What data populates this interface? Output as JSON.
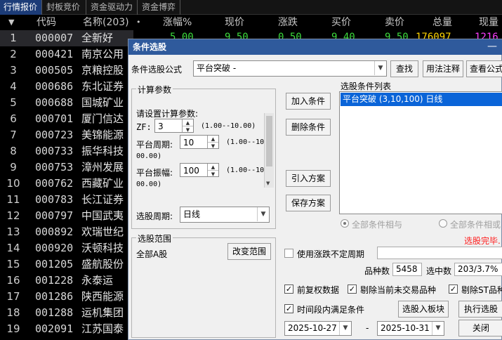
{
  "tabs": [
    "行情报价",
    "封板竞价",
    "资金驱动力",
    "资金博弈"
  ],
  "header": {
    "cols": [
      "代码",
      "名称(203)",
      "•",
      "涨幅%",
      "现价",
      "涨跌",
      "买价",
      "卖价",
      "总量",
      "现量"
    ],
    "sort_arrow": "▼"
  },
  "top_row": {
    "pct": "5.00",
    "price": "9.50",
    "chg": "0.50",
    "bid": "9.40",
    "ask": "9.50",
    "vol": "176097",
    "cur": "1216"
  },
  "rows": [
    {
      "n": "1",
      "code": "000007",
      "name": "全新好"
    },
    {
      "n": "2",
      "code": "000421",
      "name": "南京公用"
    },
    {
      "n": "3",
      "code": "000505",
      "name": "京粮控股"
    },
    {
      "n": "4",
      "code": "000686",
      "name": "东北证券"
    },
    {
      "n": "5",
      "code": "000688",
      "name": "国城矿业"
    },
    {
      "n": "6",
      "code": "000701",
      "name": "厦门信达"
    },
    {
      "n": "7",
      "code": "000723",
      "name": "美锦能源"
    },
    {
      "n": "8",
      "code": "000733",
      "name": "振华科技"
    },
    {
      "n": "9",
      "code": "000753",
      "name": "漳州发展"
    },
    {
      "n": "10",
      "code": "000762",
      "name": "西藏矿业"
    },
    {
      "n": "11",
      "code": "000783",
      "name": "长江证券"
    },
    {
      "n": "12",
      "code": "000797",
      "name": "中国武夷"
    },
    {
      "n": "13",
      "code": "000892",
      "name": "欢瑞世纪"
    },
    {
      "n": "14",
      "code": "000920",
      "name": "沃顿科技"
    },
    {
      "n": "15",
      "code": "001205",
      "name": "盛航股份"
    },
    {
      "n": "16",
      "code": "001228",
      "name": "永泰运"
    },
    {
      "n": "17",
      "code": "001286",
      "name": "陕西能源"
    },
    {
      "n": "18",
      "code": "001288",
      "name": "运机集团"
    },
    {
      "n": "19",
      "code": "002091",
      "name": "江苏国泰"
    }
  ],
  "dialog": {
    "title": "条件选股",
    "min": "—",
    "formula_label": "条件选股公式",
    "formula_value": "平台突破  -",
    "btn_find": "查找",
    "btn_usage": "用法注释",
    "btn_view": "查看公式",
    "calc_group": "计算参数",
    "calc_prompt": "请设置计算参数:",
    "params": [
      {
        "label": "ZF:",
        "value": "3",
        "range": "(1.00--10.00)",
        "range2": ""
      },
      {
        "label": "平台周期:",
        "value": "10",
        "range": "(1.00--10",
        "range2": "00.00)"
      },
      {
        "label": "平台振幅:",
        "value": "100",
        "range": "(1.00--10",
        "range2": "00.00)"
      }
    ],
    "period_label": "选股周期:",
    "period_value": "日线",
    "range_group": "选股范围",
    "range_value": "全部A股",
    "btn_change_range": "改变范围",
    "btn_add": "加入条件",
    "btn_delete": "删除条件",
    "btn_import": "引入方案",
    "btn_save": "保存方案",
    "cond_list_title": "选股条件列表",
    "cond_item": "平台突破 (3,10,100) 日线",
    "radio_and": "全部条件相与",
    "radio_or": "全部条件相或",
    "status": "选股完毕.",
    "chk_uncertain": "使用涨跌不定周期",
    "count_label": "品种数",
    "count_value": "5458",
    "hit_label": "选中数",
    "hit_value": "203/3.7%",
    "chk_fq": "前复权数据",
    "chk_exclude_untraded": "剔除当前未交易品种",
    "chk_exclude_st": "剔除ST品种",
    "chk_period": "时间段内满足条件",
    "btn_to_board": "选股入板块",
    "btn_execute": "执行选股",
    "date_from": "2025-10-27",
    "date_sep": "-",
    "date_to": "2025-10-31",
    "btn_close": "关闭"
  },
  "colors": {
    "red": "#ff3b3b",
    "green": "#3ddc3d",
    "yellow": "#ffd400",
    "magenta": "#ff3cff",
    "title_bar": "#2f5a9c",
    "tab_active": "#1c3c78"
  }
}
